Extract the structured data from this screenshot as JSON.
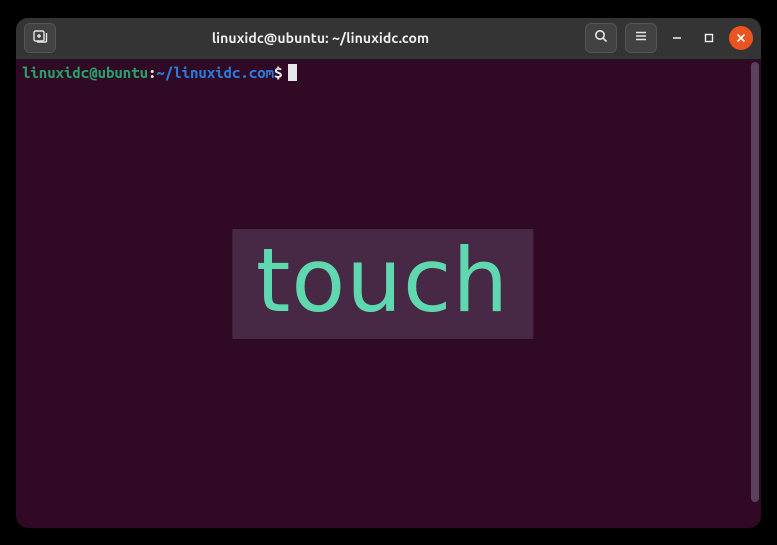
{
  "window": {
    "title": "linuxidc@ubuntu: ~/linuxidc.com"
  },
  "prompt": {
    "user_host": "linuxidc@ubuntu",
    "separator": ":",
    "path": "~/linuxidc.com",
    "symbol": "$"
  },
  "overlay": {
    "text": "touch"
  },
  "icons": {
    "new_tab": "new-tab-icon",
    "search": "search-icon",
    "menu": "hamburger-icon",
    "minimize": "minimize-icon",
    "maximize": "maximize-icon",
    "close": "close-icon"
  }
}
